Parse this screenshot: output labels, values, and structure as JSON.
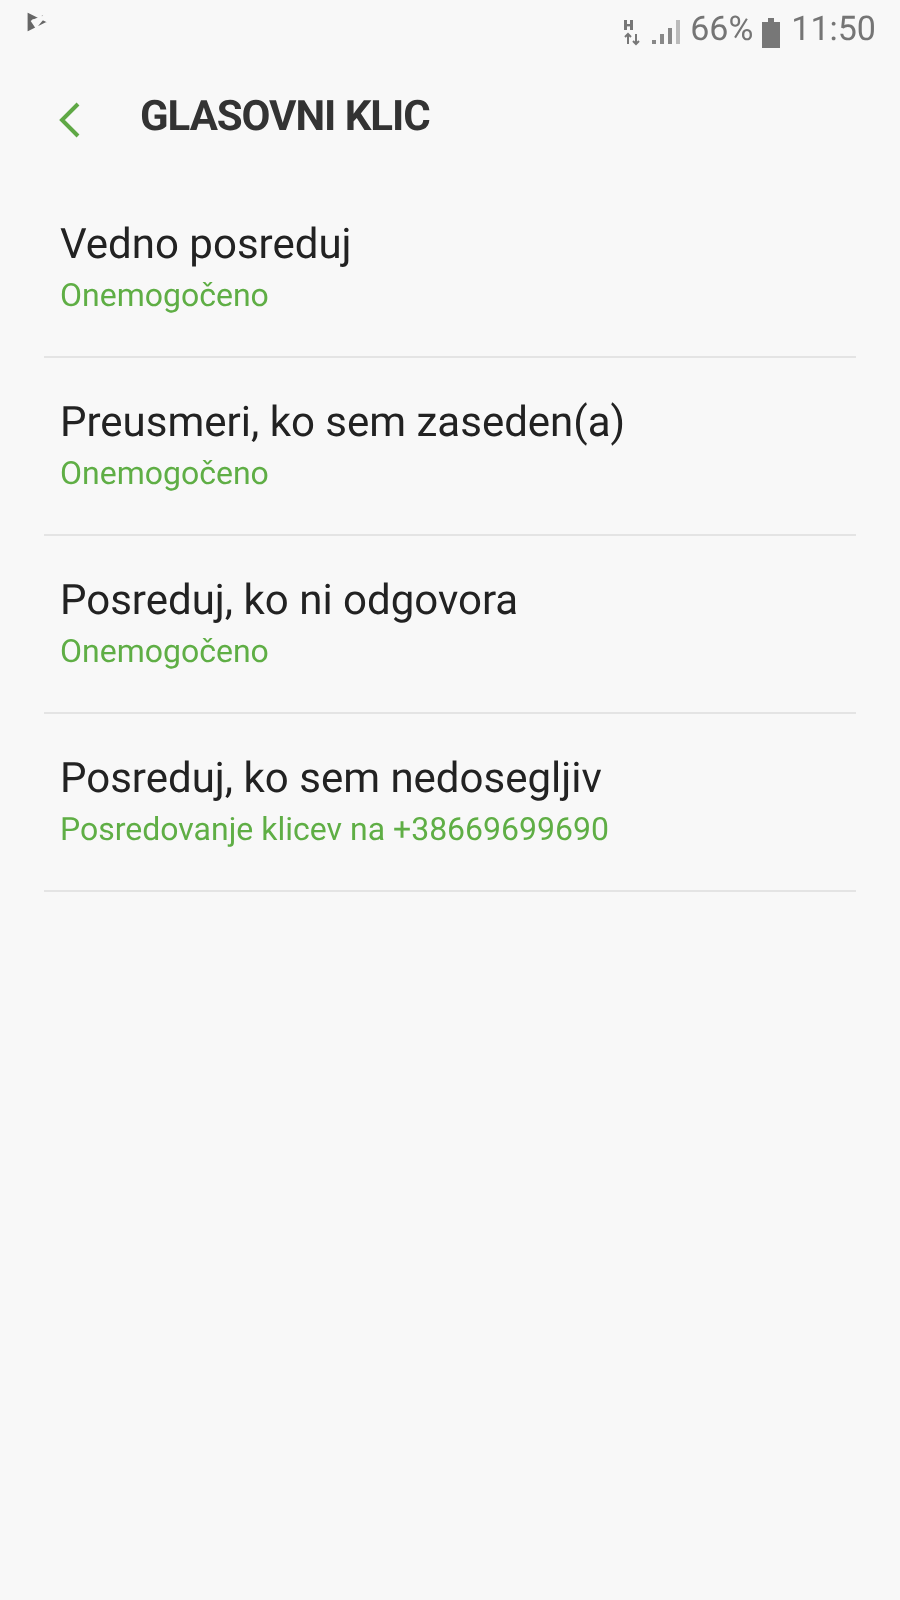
{
  "status_bar": {
    "battery": "66%",
    "time": "11:50"
  },
  "header": {
    "title": "GLASOVNI KLIC"
  },
  "items": [
    {
      "title": "Vedno posreduj",
      "summary": "Onemogočeno"
    },
    {
      "title": "Preusmeri, ko sem zaseden(a)",
      "summary": "Onemogočeno"
    },
    {
      "title": "Posreduj, ko ni odgovora",
      "summary": "Onemogočeno"
    },
    {
      "title": "Posreduj, ko sem nedosegljiv",
      "summary": "Posredovanje klicev na +38669699690"
    }
  ]
}
